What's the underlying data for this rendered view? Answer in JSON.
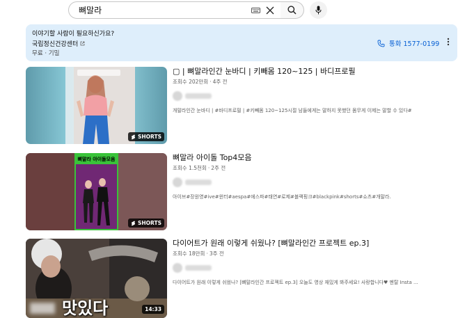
{
  "search": {
    "query": "뼈말라"
  },
  "icons": {
    "keyboard": "keyboard-icon",
    "clear": "close-icon",
    "search": "search-icon",
    "mic": "mic-icon",
    "phone": "phone-icon",
    "external": "external-link-icon",
    "more": "more-vert-icon",
    "shorts": "shorts-icon"
  },
  "banner": {
    "question": "이야기할 사람이 필요하신가요?",
    "org": "국립정신건강센터",
    "tags": "무료 · 기밀",
    "call_label": "통화 1577-0199"
  },
  "results": [
    {
      "title": "▢ | 뼈말라인간 눈바디 | 키빼몸 120~125 | 바디프로필",
      "views": "조회수 202만회",
      "age": "4주 전",
      "description": "개말라인간 눈바디 | #바디프로필 | #키빼몸 120~125시절 남들에게는 말하지 못했던 몸무게 이제는 말할 수 있다#",
      "badge": "SHORTS"
    },
    {
      "title": "뼈말라 아이돌 Top4모음",
      "views": "조회수 1.5천회",
      "age": "2주 전",
      "description": "아이브#장원영#ive#윈터#aespa#에스파#태연#로제#블랙핑크#blackpink#shorts#쇼츠#개말라.",
      "badge": "SHORTS",
      "thumb_caption": "뼈말라 아이돌모음"
    },
    {
      "title": "다이어트가 원래 이렇게 쉬웠나? [뼈말라인간 프로젝트 ep.3]",
      "views": "조회수 18만회",
      "age": "3주 전",
      "description": "다이어트가 원래 이렇게 쉬웠나? [뼈말라인간 프로젝트 ep.3] 오늘도 영상 재밌게 봐주세요! 사랑합니다♥ 멘탈 Insta ...",
      "badge": "14:33",
      "thumb_caption": "맛있다"
    }
  ],
  "colors": {
    "banner_bg": "#deeefb",
    "link_blue": "#065fd4"
  }
}
